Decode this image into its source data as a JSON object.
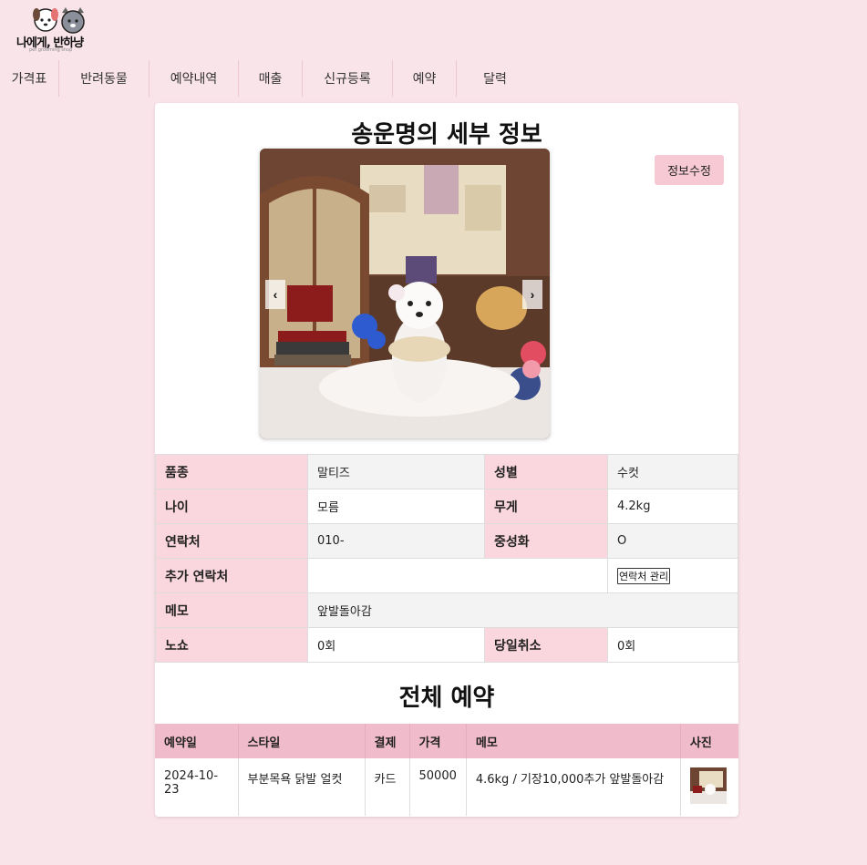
{
  "brand": {
    "logo_text": "나에게, 반하냥",
    "logo_sub": "pet grooming shop"
  },
  "nav": [
    {
      "label": "가격표"
    },
    {
      "label": "반려동물"
    },
    {
      "label": "예약내역"
    },
    {
      "label": "매출"
    },
    {
      "label": "신규등록"
    },
    {
      "label": "예약"
    },
    {
      "label": "달력"
    }
  ],
  "detail": {
    "title": "송운명의 세부 정보",
    "edit_label": "정보수정",
    "prev_label": "‹",
    "next_label": "›",
    "rows": {
      "breed_label": "품종",
      "breed": "말티즈",
      "sex_label": "성별",
      "sex": "수컷",
      "age_label": "나이",
      "age": "모름",
      "weight_label": "무게",
      "weight": "4.2kg",
      "phone_label": "연락처",
      "phone": "010-",
      "neuter_label": "중성화",
      "neuter": "O",
      "extra_label": "추가 연락처",
      "extra": "",
      "contact_btn": "연락처 관리",
      "memo_label": "메모",
      "memo": "앞발돌아감",
      "noshow_label": "노쇼",
      "noshow": "0회",
      "cancel_label": "당일취소",
      "cancel": "0회"
    }
  },
  "reservations": {
    "title": "전체 예약",
    "headers": [
      "예약일",
      "스타일",
      "결제",
      "가격",
      "메모",
      "사진"
    ],
    "rows": [
      {
        "date": "2024-10-23",
        "style": "부분목욕 닭발 얼컷",
        "payment": "카드",
        "price": "50000",
        "memo": "4.6kg / 기장10,000추가 앞발돌아감"
      }
    ]
  },
  "colors": {
    "background": "#f9e4ea",
    "label_bg": "#fad7de",
    "header_bg": "#f0bccb",
    "button_bg": "#f6c9d4"
  }
}
